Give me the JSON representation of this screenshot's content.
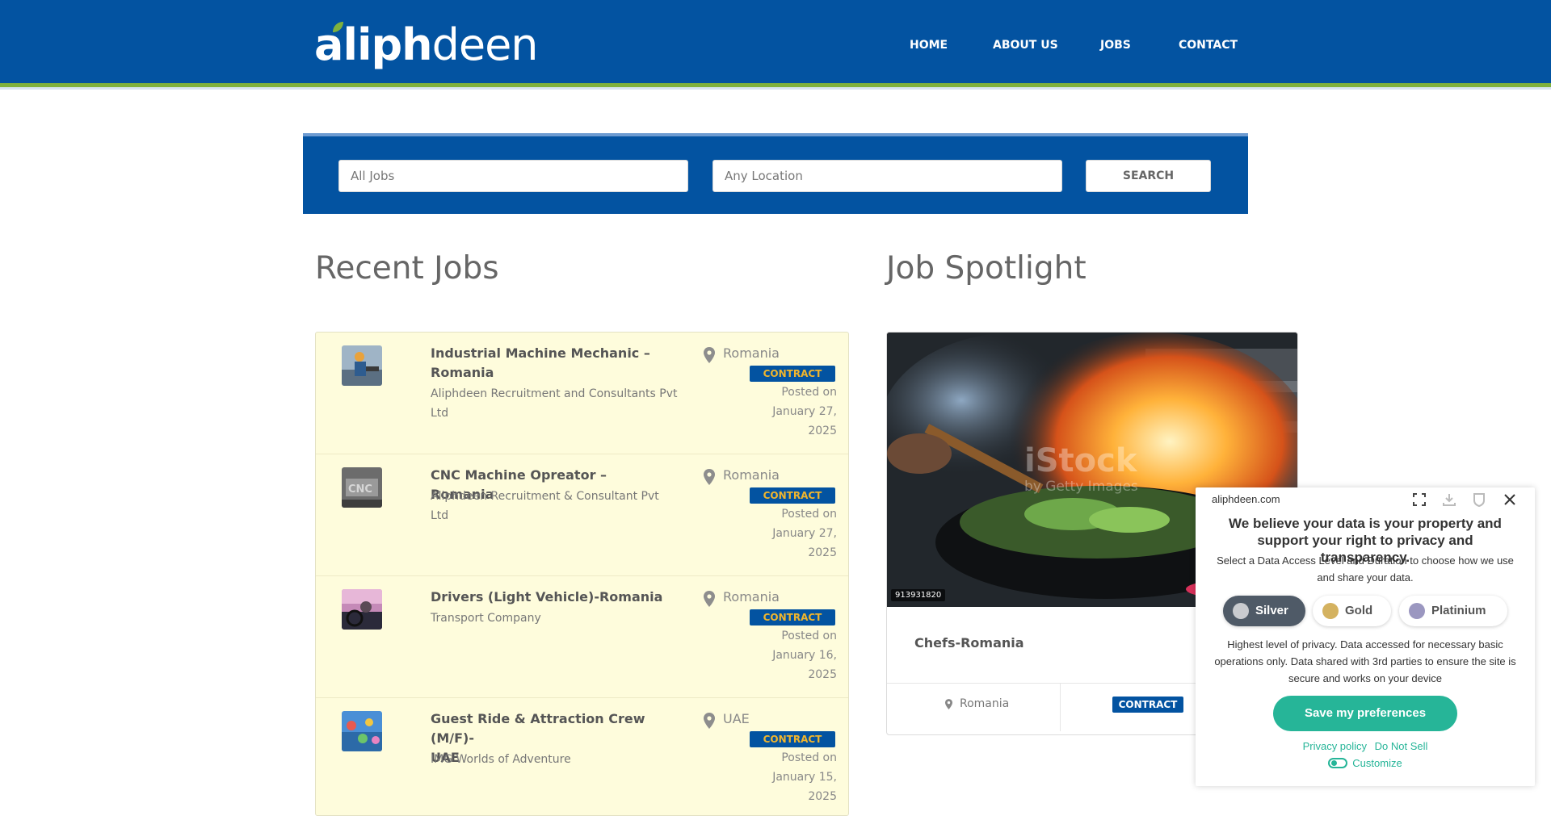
{
  "header": {
    "logo_bold": "aliph",
    "logo_thin": "deen",
    "nav": [
      {
        "label": "HOME"
      },
      {
        "label": "ABOUT US"
      },
      {
        "label": "JOBS"
      },
      {
        "label": "CONTACT"
      }
    ],
    "brand_color": "#0353a1",
    "accent_color": "#7fb13d"
  },
  "search": {
    "keyword_value": "All Jobs",
    "location_value": "Any Location",
    "button_label": "SEARCH"
  },
  "recent_jobs": {
    "title": "Recent Jobs",
    "items": [
      {
        "title_line1": "Industrial Machine Mechanic –",
        "title_line2": "Romania",
        "company_line1": "Aliphdeen Recruitment and Consultants Pvt",
        "company_line2": "Ltd",
        "location": "Romania",
        "type": "CONTRACT",
        "posted_line1": "Posted on",
        "posted_line2": "January 27,",
        "posted_line3": "2025",
        "thumb_icon": "mechanic-thumbnail"
      },
      {
        "title_line1": "CNC Machine Opreator – Romania",
        "title_line2": "",
        "company_line1": "Aliphdeen Recruitment & Consultant Pvt",
        "company_line2": "Ltd",
        "location": "Romania",
        "type": "CONTRACT",
        "posted_line1": "Posted on",
        "posted_line2": "January 27,",
        "posted_line3": "2025",
        "thumb_icon": "cnc-thumbnail"
      },
      {
        "title_line1": "Drivers (Light Vehicle)-Romania",
        "title_line2": "",
        "company_line1": "Transport Company",
        "company_line2": "",
        "location": "Romania",
        "type": "CONTRACT",
        "posted_line1": "Posted on",
        "posted_line2": "January 16,",
        "posted_line3": "2025",
        "thumb_icon": "driver-thumbnail"
      },
      {
        "title_line1": "Guest Ride & Attraction Crew (M/F)-",
        "title_line2": "UAE",
        "company_line1": "IMG Worlds of Adventure",
        "company_line2": "",
        "location": "UAE",
        "type": "CONTRACT",
        "posted_line1": "Posted on",
        "posted_line2": "January 15,",
        "posted_line3": "2025",
        "thumb_icon": "ride-thumbnail"
      }
    ]
  },
  "spotlight": {
    "title": "Job Spotlight",
    "image_id": "913931820",
    "watermark_big": "iStock",
    "watermark_small": "by Getty Images",
    "job_title": "Chefs-Romania",
    "location": "Romania",
    "type": "CONTRACT"
  },
  "consent": {
    "domain": "aliphdeen.com",
    "heading": "We believe your data is your property and support your right to privacy and transparency.",
    "subtext": "Select a Data Access Level and Duration to choose how we use and share your data.",
    "levels": [
      {
        "label": "Silver",
        "color": "#c9cbcf",
        "active": true
      },
      {
        "label": "Gold",
        "color": "#d4b260",
        "active": false
      },
      {
        "label": "Platinium",
        "color": "#9b97c0",
        "active": false
      }
    ],
    "description": "Highest level of privacy. Data accessed for necessary basic operations only. Data shared with 3rd parties to ensure the site is secure and works on your device",
    "save_label": "Save my preferences",
    "privacy_label": "Privacy policy",
    "donotsell_label": "Do Not Sell",
    "customize_label": "Customize",
    "accent_color": "#26b598"
  }
}
